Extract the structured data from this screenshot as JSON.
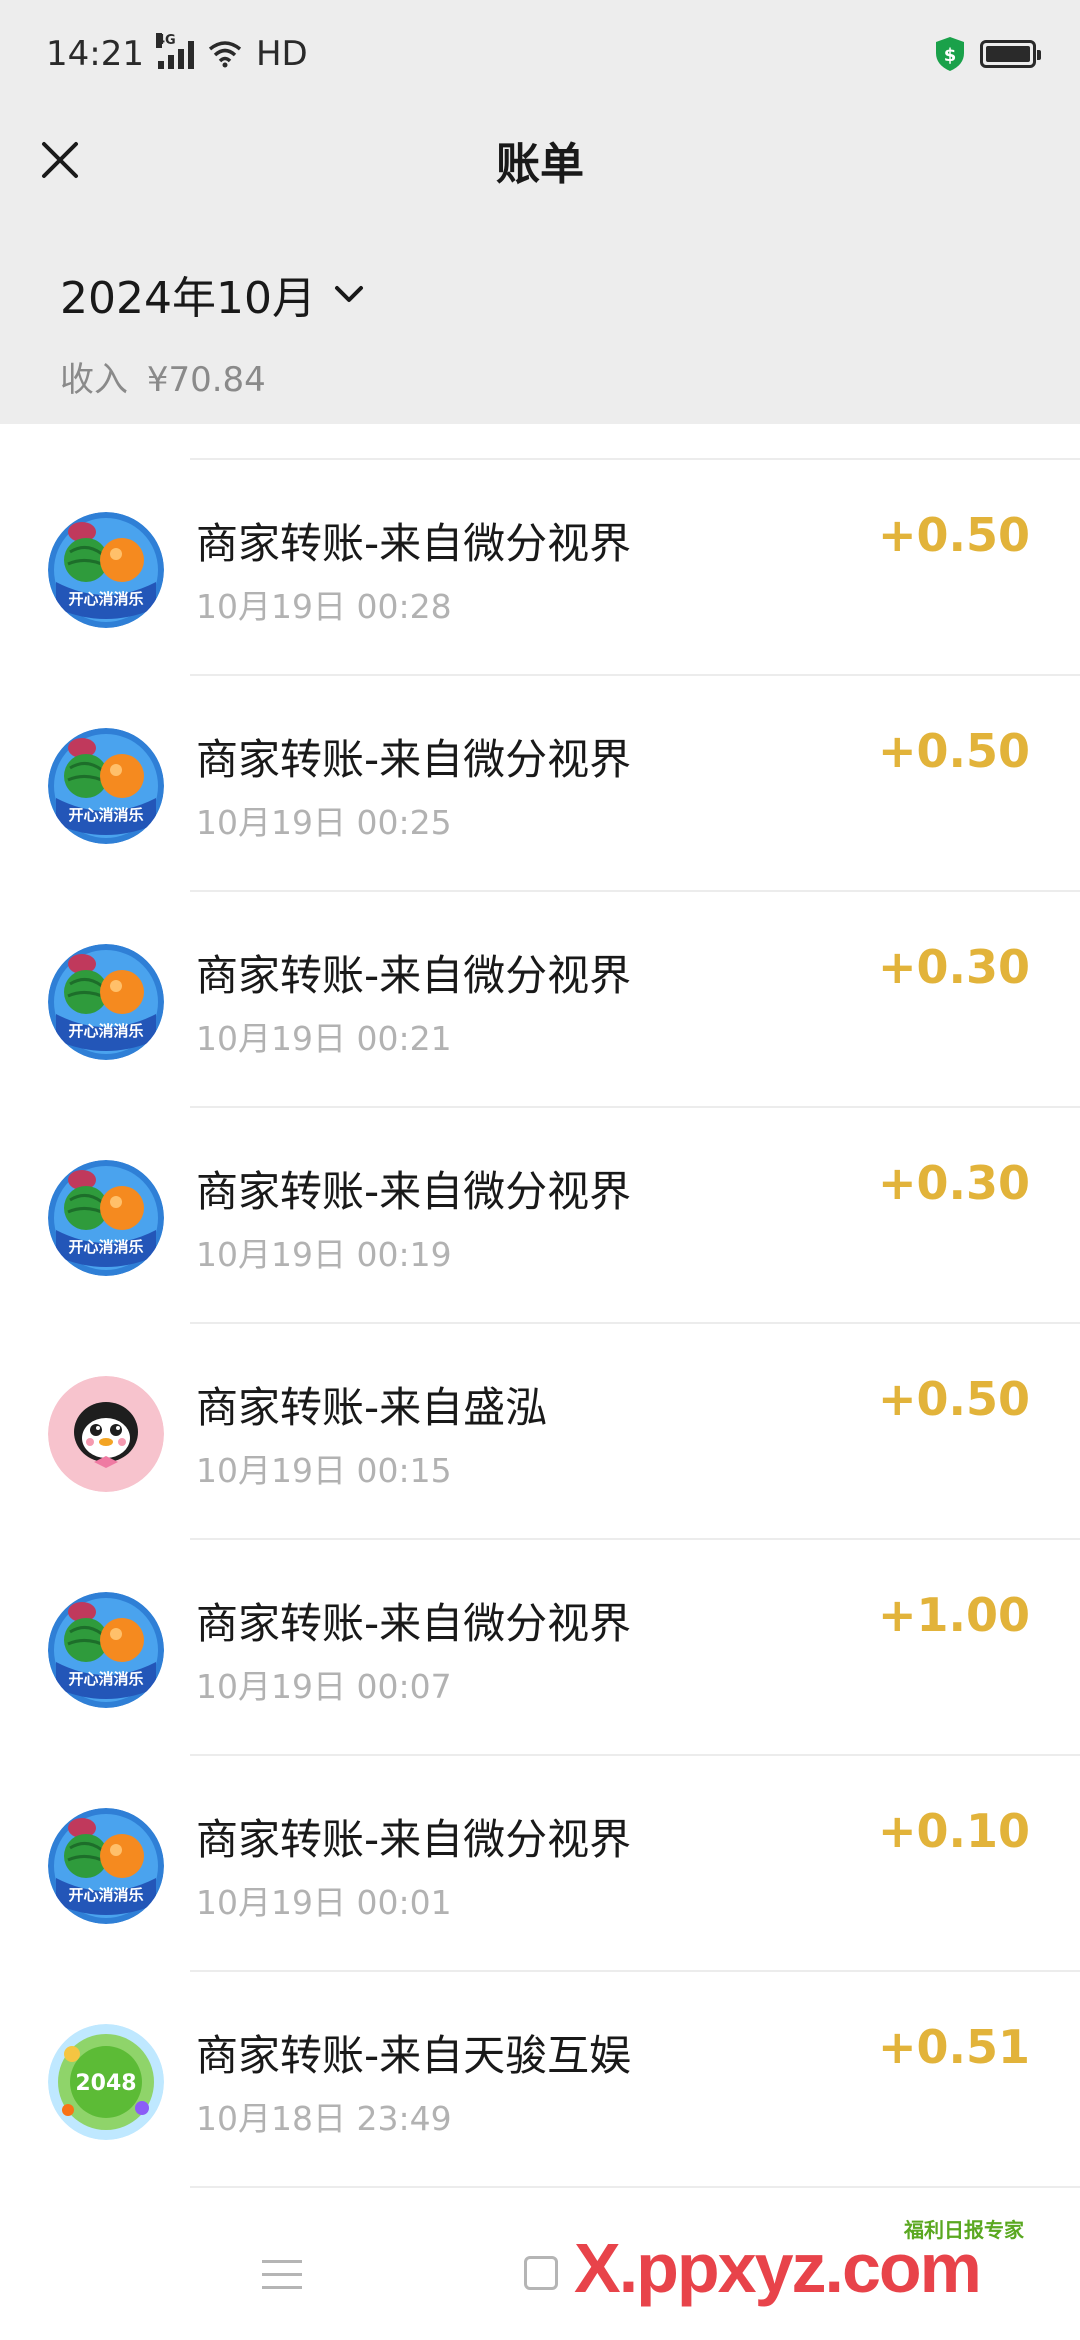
{
  "status_bar": {
    "time": "14:21",
    "network": "4G",
    "hd": "HD"
  },
  "header": {
    "title": "账单"
  },
  "summary": {
    "month": "2024年10月",
    "income_label": "收入",
    "income_value": "¥70.84"
  },
  "transactions": [
    {
      "name": "商家转账-来自微分视界",
      "time": "10月19日 00:28",
      "amount": "+0.50",
      "avatar": "match-game-avatar"
    },
    {
      "name": "商家转账-来自微分视界",
      "time": "10月19日 00:25",
      "amount": "+0.50",
      "avatar": "match-game-avatar"
    },
    {
      "name": "商家转账-来自微分视界",
      "time": "10月19日 00:21",
      "amount": "+0.30",
      "avatar": "match-game-avatar"
    },
    {
      "name": "商家转账-来自微分视界",
      "time": "10月19日 00:19",
      "amount": "+0.30",
      "avatar": "match-game-avatar"
    },
    {
      "name": "商家转账-来自盛泓",
      "time": "10月19日 00:15",
      "amount": "+0.50",
      "avatar": "penguin-avatar"
    },
    {
      "name": "商家转账-来自微分视界",
      "time": "10月19日 00:07",
      "amount": "+1.00",
      "avatar": "match-game-avatar"
    },
    {
      "name": "商家转账-来自微分视界",
      "time": "10月19日 00:01",
      "amount": "+0.10",
      "avatar": "match-game-avatar"
    },
    {
      "name": "商家转账-来自天骏互娱",
      "time": "10月18日 23:49",
      "amount": "+0.51",
      "avatar": "2048-game-avatar"
    }
  ],
  "avatar_labels": {
    "match_game": "开心消消乐",
    "game_2048": "2048"
  },
  "watermark": {
    "text": "X.ppxyz.com",
    "small": "福利日报专家"
  },
  "colors": {
    "amount": "#e2b33a",
    "header_bg": "#ededed"
  }
}
